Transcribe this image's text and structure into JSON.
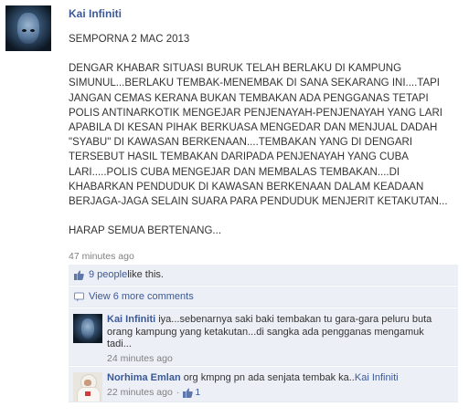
{
  "post": {
    "author": "Kai Infiniti",
    "title": "SEMPORNA 2 MAC 2013",
    "body_lines": [
      "DENGAR KHABAR SITUASI BURUK TELAH BERLAKU DI KAMPUNG",
      "SIMUNUL...BERLAKU TEMBAK-MENEMBAK DI SANA SEKARANG INI....TAPI",
      "JANGAN CEMAS KERANA BUKAN TEMBAKAN ADA PENGGANAS TETAPI",
      "POLIS ANTINARKOTIK MENGEJAR PENJENAYAH-PENJENAYAH YANG LARI",
      "APABILA DI KESAN PIHAK BERKUASA MENGEDAR DAN MENJUAL DADAH",
      "\"SYABU\" DI KAWASAN BERKENAAN....TEMBAKAN YANG DI DENGARI",
      "TERSEBUT HASIL TEMBAKAN DARIPADA PENJENAYAH YANG CUBA",
      "LARI.....POLIS CUBA MENGEJAR DAN MEMBALAS TEMBAKAN....DI",
      "KHABARKAN PENDUDUK DI KAWASAN BERKENAAN DALAM KEADAAN",
      "BERJAGA-JAGA SELAIN SUARA PARA PENDUDUK MENJERIT KETAKUTAN..."
    ],
    "closing": "HARAP SEMUA BERTENANG...",
    "timestamp": "47 minutes ago"
  },
  "likes": {
    "people": "9 people",
    "suffix": " like this."
  },
  "view_more": "View 6 more comments",
  "comments": [
    {
      "author": "Kai Infiniti",
      "text": "iya...sebenarnya saki baki tembakan tu gara-gara peluru buta orang kampung yang ketakutan...di sangka ada pengganas mengamuk tadi...",
      "time": "24 minutes ago"
    },
    {
      "author": "Norhima Emlan",
      "text": "org kmpng pn ada senjata tembak ka..",
      "mention": "Kai Infiniti",
      "time": "22 minutes ago",
      "likes": "1"
    }
  ],
  "colors": {
    "link": "#3b5998",
    "panel": "#eceff5",
    "meta": "#808080"
  }
}
